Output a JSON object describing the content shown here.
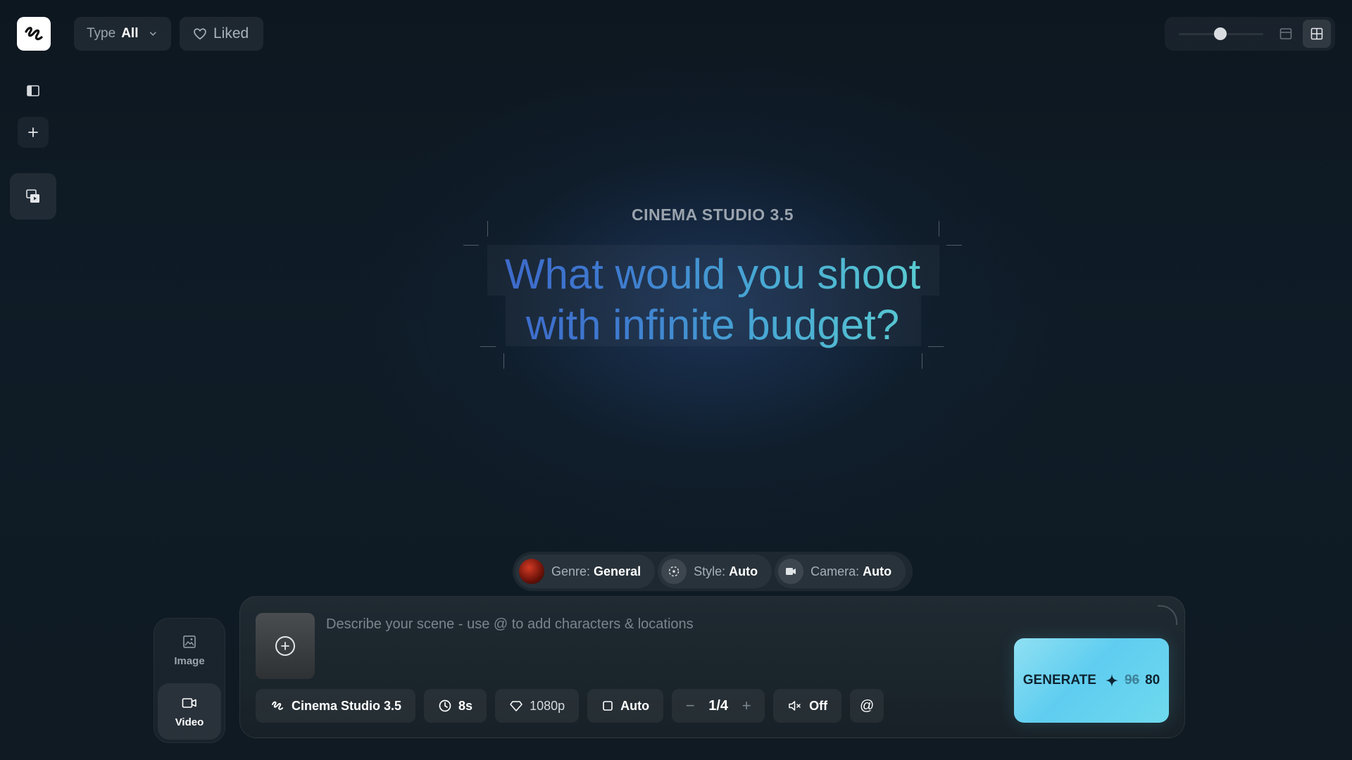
{
  "header": {
    "type_filter": {
      "label": "Type",
      "value": "All"
    },
    "liked_label": "Liked"
  },
  "hero": {
    "eyebrow": "CINEMA STUDIO 3.5",
    "line1": "What would you shoot",
    "line2": "with infinite budget?"
  },
  "chips": {
    "genre": {
      "label": "Genre:",
      "value": "General"
    },
    "style": {
      "label": "Style:",
      "value": "Auto"
    },
    "camera": {
      "label": "Camera:",
      "value": "Auto"
    }
  },
  "modes": {
    "image_label": "Image",
    "video_label": "Video",
    "selected": "Video"
  },
  "prompt": {
    "placeholder": "Describe your scene - use @ to add characters & locations",
    "value": ""
  },
  "toolbar": {
    "model": "Cinema Studio 3.5",
    "duration": "8s",
    "resolution": "1080p",
    "aspect": "Auto",
    "count": "1/4",
    "minus": "−",
    "plus": "+",
    "audio": "Off",
    "mention": "@"
  },
  "generate": {
    "label": "GENERATE",
    "old_cost": "96",
    "new_cost": "80"
  },
  "colors": {
    "accent_generate": "#6fd4f0",
    "headline_start": "#3d64c8",
    "headline_end": "#5dd3cf"
  },
  "icons": {
    "logo": "brand-squiggle-icon",
    "sidebar": "sidebar-toggle-icon",
    "add": "plus-icon",
    "media": "media-library-icon",
    "heart": "heart-icon",
    "chevron": "chevron-down-icon",
    "single_view": "single-column-icon",
    "grid_view": "grid-icon",
    "clock": "clock-icon",
    "diamond": "diamond-icon",
    "square": "square-icon",
    "mute": "speaker-muted-icon",
    "sparkle": "sparkle-icon"
  }
}
